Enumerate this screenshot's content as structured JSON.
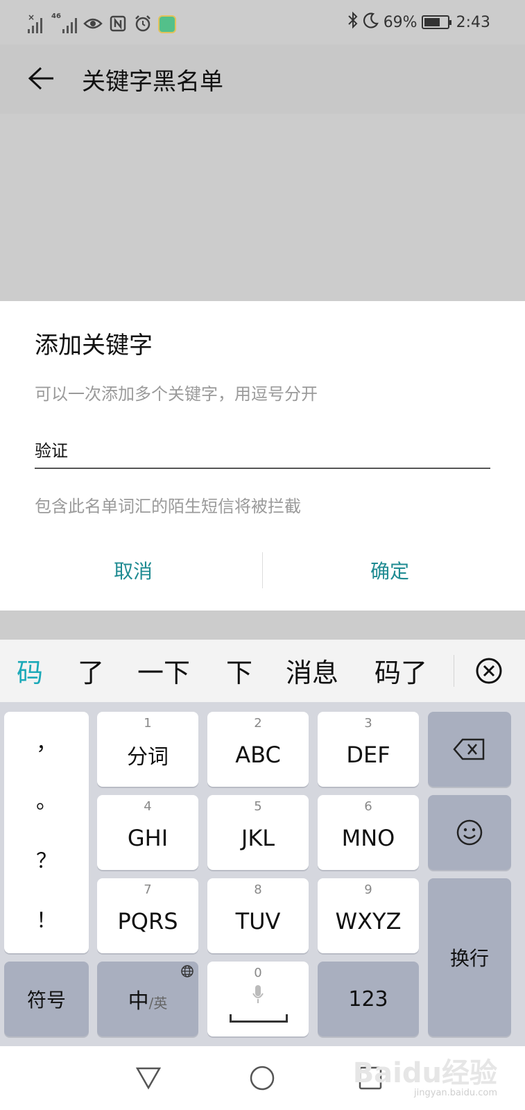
{
  "status_bar": {
    "network_tag": "46",
    "battery": "69%",
    "battery_level": 0.69,
    "time": "2:43",
    "icons": [
      "no-sim-signal-icon",
      "signal-4g-icon",
      "eye-icon",
      "nfc-icon",
      "alarm-icon",
      "app-notification-icon",
      "bluetooth-icon",
      "moon-icon",
      "battery-icon"
    ]
  },
  "header": {
    "back_icon": "arrow-left-icon",
    "title": "关键字黑名单"
  },
  "dialog": {
    "title": "添加关键字",
    "hint": "可以一次添加多个关键字，用逗号分开",
    "input_value": "验证",
    "note": "包含此名单词汇的陌生短信将被拦截",
    "cancel_label": "取消",
    "confirm_label": "确定",
    "accent_color": "#1f8b92"
  },
  "candidates": {
    "items": [
      "码",
      "了",
      "一下",
      "下",
      "消息",
      "码了"
    ],
    "active_color": "#1ba9b8",
    "close_icon": "circle-x-icon"
  },
  "keyboard": {
    "punctuation": [
      "，",
      "。",
      "？",
      "！"
    ],
    "keys": [
      {
        "num": "1",
        "label": "分词"
      },
      {
        "num": "2",
        "label": "ABC"
      },
      {
        "num": "3",
        "label": "DEF"
      },
      {
        "num": "4",
        "label": "GHI"
      },
      {
        "num": "5",
        "label": "JKL"
      },
      {
        "num": "6",
        "label": "MNO"
      },
      {
        "num": "7",
        "label": "PQRS"
      },
      {
        "num": "8",
        "label": "TUV"
      },
      {
        "num": "9",
        "label": "WXYZ"
      }
    ],
    "backspace_icon": "backspace-icon",
    "emoji_icon": "smiley-icon",
    "enter_label": "换行",
    "symbols_label": "符号",
    "lang_main": "中",
    "lang_sub": "/英",
    "lang_icon": "globe-icon",
    "space_num": "0",
    "mic_icon": "microphone-icon",
    "numbers_label": "123"
  },
  "nav_bar": {
    "back_icon": "triangle-back-icon",
    "home_icon": "circle-home-icon",
    "recents_icon": "square-recents-icon",
    "watermark": "Baidu经验",
    "watermark_sub": "jingyan.baidu.com"
  }
}
